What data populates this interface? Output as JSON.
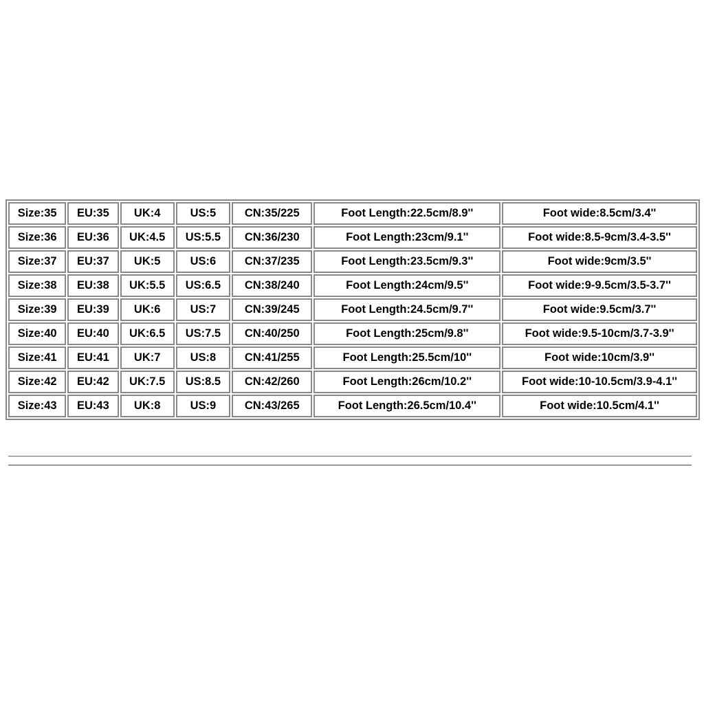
{
  "chart_data": {
    "type": "table",
    "columns": [
      "Size",
      "EU",
      "UK",
      "US",
      "CN",
      "Foot Length",
      "Foot wide"
    ],
    "rows": [
      {
        "size": "Size:35",
        "eu": "EU:35",
        "uk": "UK:4",
        "us": "US:5",
        "cn": "CN:35/225",
        "length": "Foot Length:22.5cm/8.9''",
        "wide": "Foot wide:8.5cm/3.4''"
      },
      {
        "size": "Size:36",
        "eu": "EU:36",
        "uk": "UK:4.5",
        "us": "US:5.5",
        "cn": "CN:36/230",
        "length": "Foot Length:23cm/9.1''",
        "wide": "Foot wide:8.5-9cm/3.4-3.5''"
      },
      {
        "size": "Size:37",
        "eu": "EU:37",
        "uk": "UK:5",
        "us": "US:6",
        "cn": "CN:37/235",
        "length": "Foot Length:23.5cm/9.3''",
        "wide": "Foot wide:9cm/3.5''"
      },
      {
        "size": "Size:38",
        "eu": "EU:38",
        "uk": "UK:5.5",
        "us": "US:6.5",
        "cn": "CN:38/240",
        "length": "Foot Length:24cm/9.5''",
        "wide": "Foot wide:9-9.5cm/3.5-3.7''"
      },
      {
        "size": "Size:39",
        "eu": "EU:39",
        "uk": "UK:6",
        "us": "US:7",
        "cn": "CN:39/245",
        "length": "Foot Length:24.5cm/9.7''",
        "wide": "Foot wide:9.5cm/3.7''"
      },
      {
        "size": "Size:40",
        "eu": "EU:40",
        "uk": "UK:6.5",
        "us": "US:7.5",
        "cn": "CN:40/250",
        "length": "Foot Length:25cm/9.8''",
        "wide": "Foot wide:9.5-10cm/3.7-3.9''"
      },
      {
        "size": "Size:41",
        "eu": "EU:41",
        "uk": "UK:7",
        "us": "US:8",
        "cn": "CN:41/255",
        "length": "Foot Length:25.5cm/10''",
        "wide": "Foot wide:10cm/3.9''"
      },
      {
        "size": "Size:42",
        "eu": "EU:42",
        "uk": "UK:7.5",
        "us": "US:8.5",
        "cn": "CN:42/260",
        "length": "Foot Length:26cm/10.2''",
        "wide": "Foot wide:10-10.5cm/3.9-4.1''"
      },
      {
        "size": "Size:43",
        "eu": "EU:43",
        "uk": "UK:8",
        "us": "US:9",
        "cn": "CN:43/265",
        "length": "Foot Length:26.5cm/10.4''",
        "wide": "Foot wide:10.5cm/4.1''"
      }
    ]
  }
}
